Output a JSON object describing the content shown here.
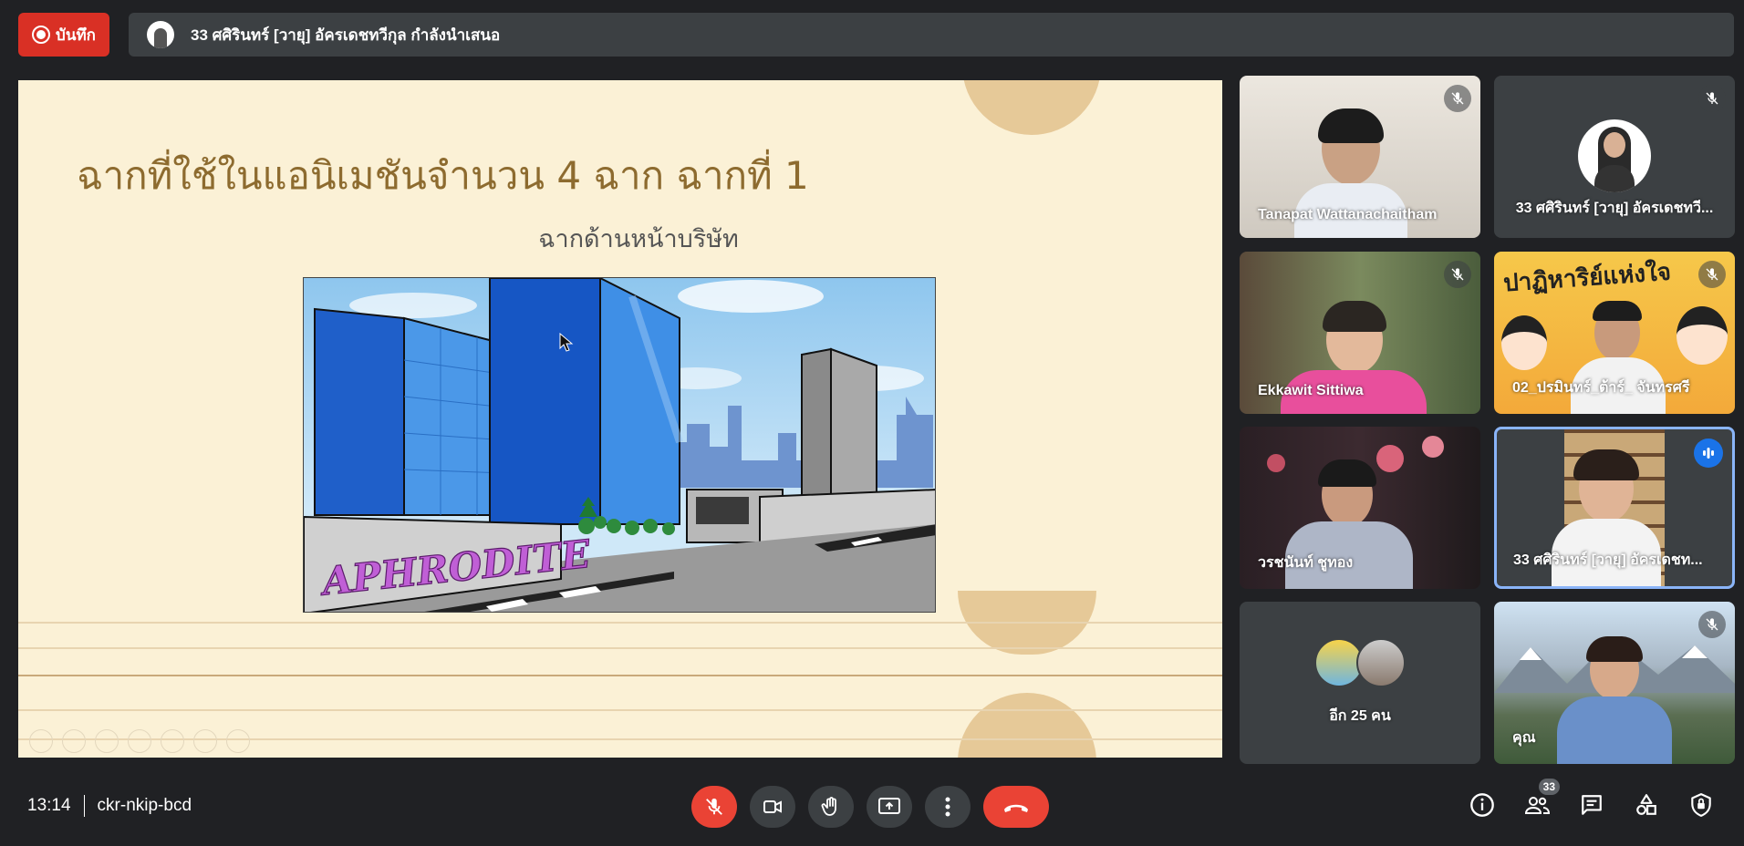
{
  "top_bar": {
    "record_label": "บันทึก",
    "presenter_text": "33 ศศิรินทร์ [วายุ] อัครเดชทวีกุล กำลังนำเสนอ"
  },
  "slide": {
    "title": "ฉากที่ใช้ในแอนิเมชันจำนวน 4 ฉาก ฉากที่ 1",
    "subtitle": "ฉากด้านหน้าบริษัท",
    "sign_text": "APHRODITE"
  },
  "participants": [
    {
      "name": "Tanapat Wattanachaitham",
      "muted": true
    },
    {
      "name": "33 ศศิรินทร์ [วายุ] อัครเดชทวี...",
      "muted": true
    },
    {
      "name": "Ekkawit Sittiwa",
      "muted": true
    },
    {
      "name": "02_ปรมินทร์_ต้าร์_ จันทรศรี",
      "muted": true
    },
    {
      "name": "วรชนันท์ ชูทอง",
      "muted": false
    },
    {
      "name": "33 ศศิรินทร์ [วายุ] อัครเดชท...",
      "speaking": true
    },
    {
      "name": "อีก 25 คน"
    },
    {
      "name": "คุณ",
      "muted": true
    }
  ],
  "tile_banner": "ปาฏิหาริย์แห่งใจ",
  "bottom_bar": {
    "time": "13:14",
    "meeting_code": "ckr-nkip-bcd",
    "participant_count": "33"
  },
  "colors": {
    "background": "#202124",
    "tile": "#3c4043",
    "record_red": "#d93025",
    "hangup_red": "#ea4335",
    "speaking_blue": "#1a73e8"
  }
}
